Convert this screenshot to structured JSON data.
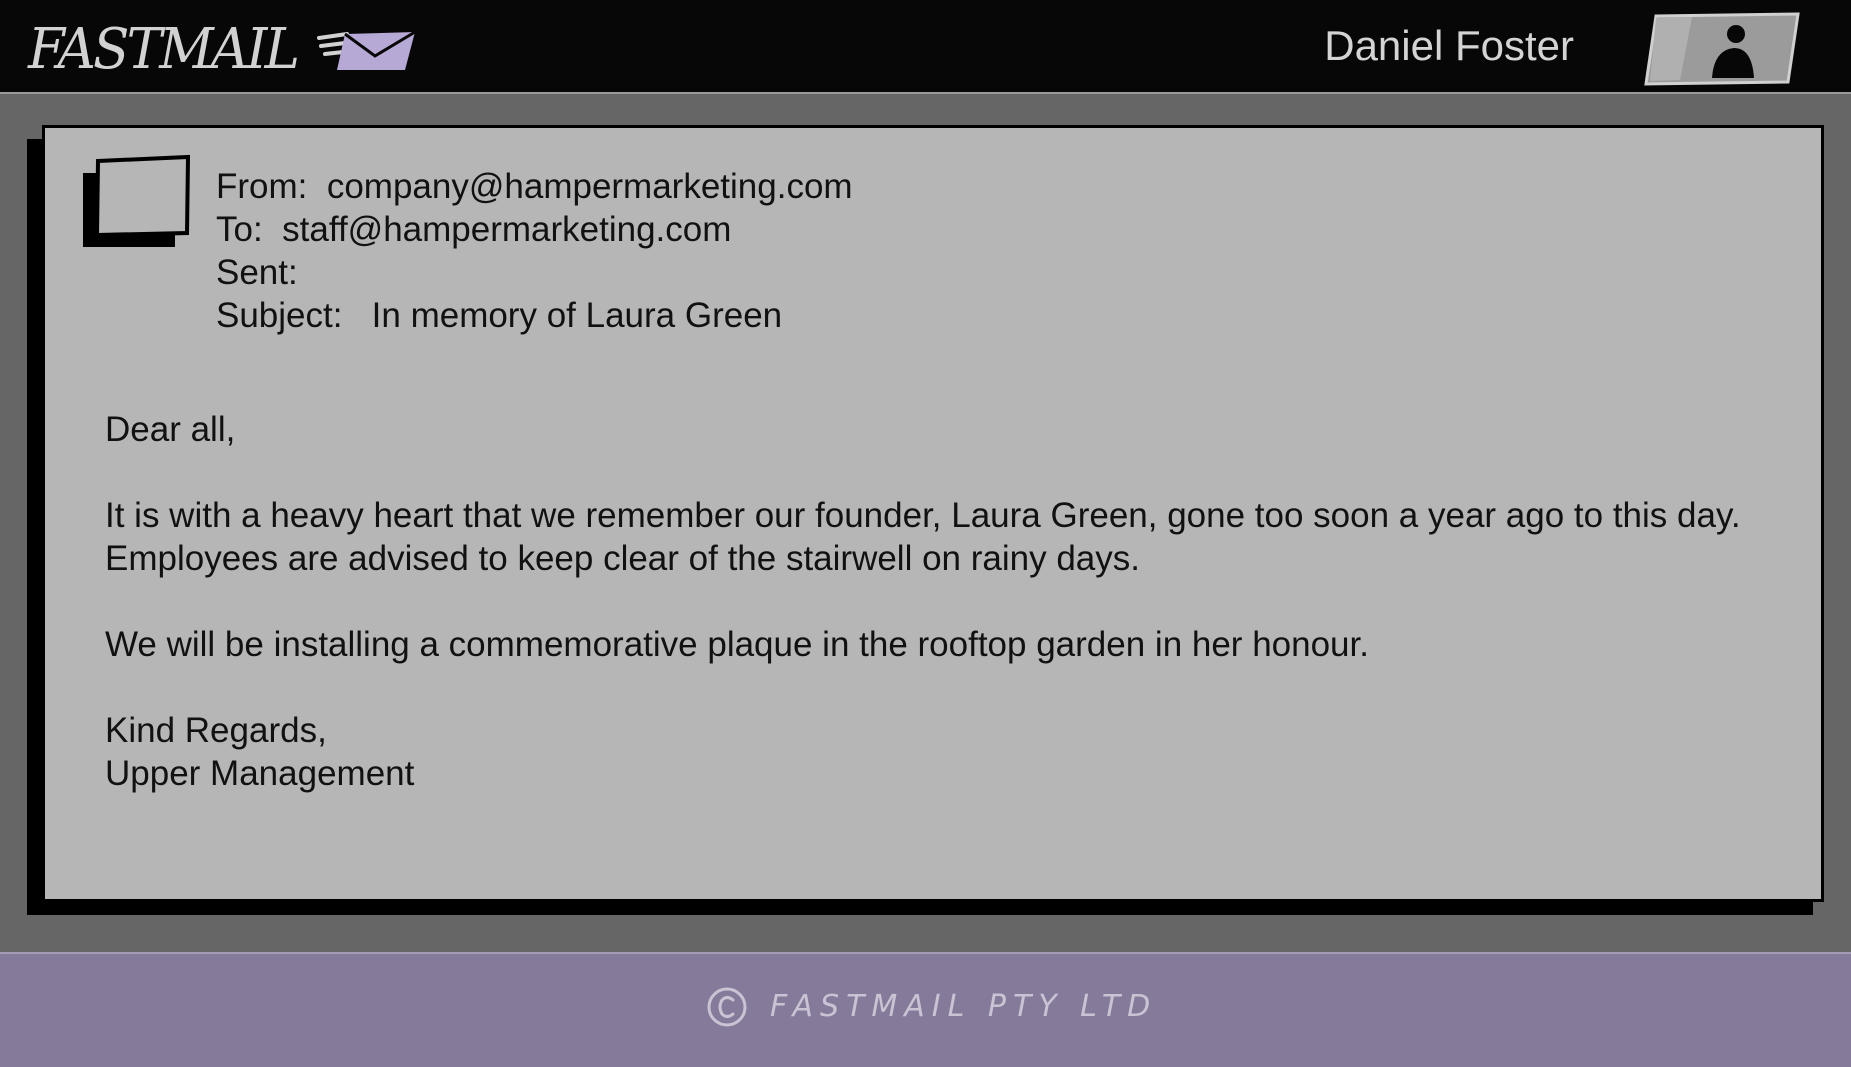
{
  "app": {
    "logo_text": "FASTMAIL",
    "user_name": "Daniel Foster",
    "colors": {
      "header_bg": "#070707",
      "page_bg": "#666666",
      "card_bg": "#b6b6b6",
      "footer_bg": "#867a9a",
      "envelope": "#b7a9d6"
    }
  },
  "email": {
    "from_label": "From:",
    "from_value": "company@hampermarketing.com",
    "to_label": "To:",
    "to_value": "staff@hampermarketing.com",
    "sent_label": "Sent:",
    "sent_value": "",
    "subject_label": "Subject:",
    "subject_value": "In memory of Laura Green",
    "greeting": "Dear all,",
    "paragraph1_line1": "It is with a heavy heart that we remember our founder, Laura Green, gone too soon a year ago to this day.",
    "paragraph1_line2": "Employees are advised to keep clear of the stairwell on rainy days.",
    "paragraph2": "We will be installing a commemorative plaque in the rooftop garden in her honour.",
    "signoff": "Kind Regards,",
    "signature": "Upper Management"
  },
  "footer": {
    "copyright_symbol": "copyright-icon",
    "text": "FASTMAIL PTY LTD"
  }
}
